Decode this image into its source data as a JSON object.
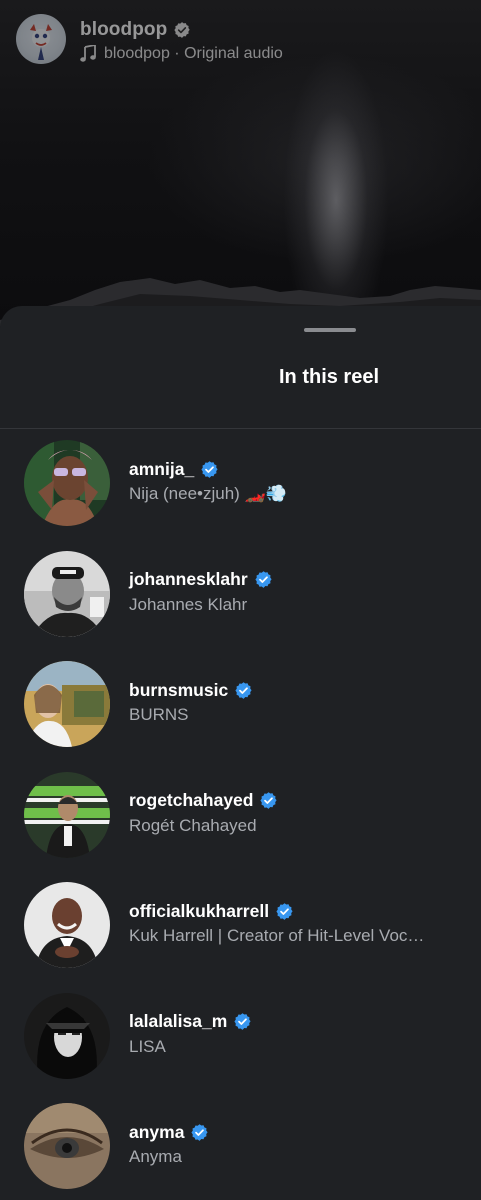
{
  "reel": {
    "author": "bloodpop",
    "audio": "bloodpop · Original audio",
    "icons": {
      "verified": "verified-badge-icon",
      "audio": "music-note-icon"
    }
  },
  "sheet": {
    "title": "In this reel"
  },
  "colors": {
    "sheet_bg": "#1f2124",
    "verified_blue": "#3897f0",
    "secondary_text": "#a8abb0"
  },
  "people": [
    {
      "username": "amnija_",
      "fullname": "Nija (nee•zjuh) 🏎️💨",
      "verified": true
    },
    {
      "username": "johannesklahr",
      "fullname": "Johannes Klahr",
      "verified": true
    },
    {
      "username": "burnsmusic",
      "fullname": "BURNS",
      "verified": true
    },
    {
      "username": "rogetchahayed",
      "fullname": "Rogét Chahayed",
      "verified": true
    },
    {
      "username": "officialkukharrell",
      "fullname": "Kuk Harrell | Creator of Hit-Level Voc…",
      "verified": true
    },
    {
      "username": "lalalalisa_m",
      "fullname": "LISA",
      "verified": true
    },
    {
      "username": "anyma",
      "fullname": "Anyma",
      "verified": true
    }
  ]
}
